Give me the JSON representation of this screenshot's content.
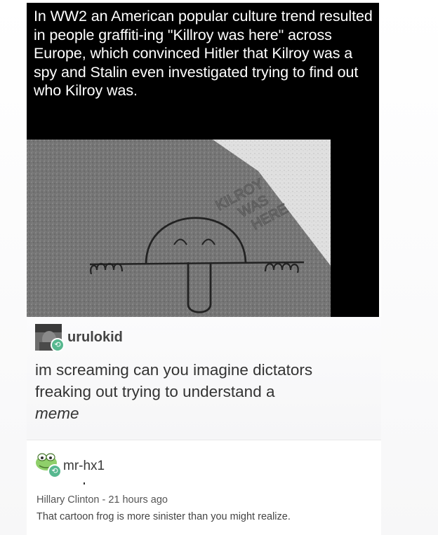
{
  "post": {
    "text": "In WW2 an American popular culture trend resulted in people graffiti-ing \"Killroy was here\" across Europe, which convinced Hitler that Kilroy was a spy and Stalin even investigated trying to find out who Kilroy was.",
    "image": {
      "graffiti_text": [
        "KILROY",
        "WAS",
        "HERE"
      ]
    }
  },
  "reply1": {
    "username": "urulokid",
    "text": "im screaming can you imagine dictators freaking out trying to understand a",
    "text_italic": "meme"
  },
  "reply2": {
    "username": "mr-hx1",
    "meta": "Hillary Clinton - 21 hours ago",
    "text": "That cartoon frog is more sinister than you might realize."
  },
  "icons": {
    "reblog": "reblog-icon"
  },
  "colors": {
    "header_bg": "#000000",
    "reblog_badge": "#57b88f"
  }
}
